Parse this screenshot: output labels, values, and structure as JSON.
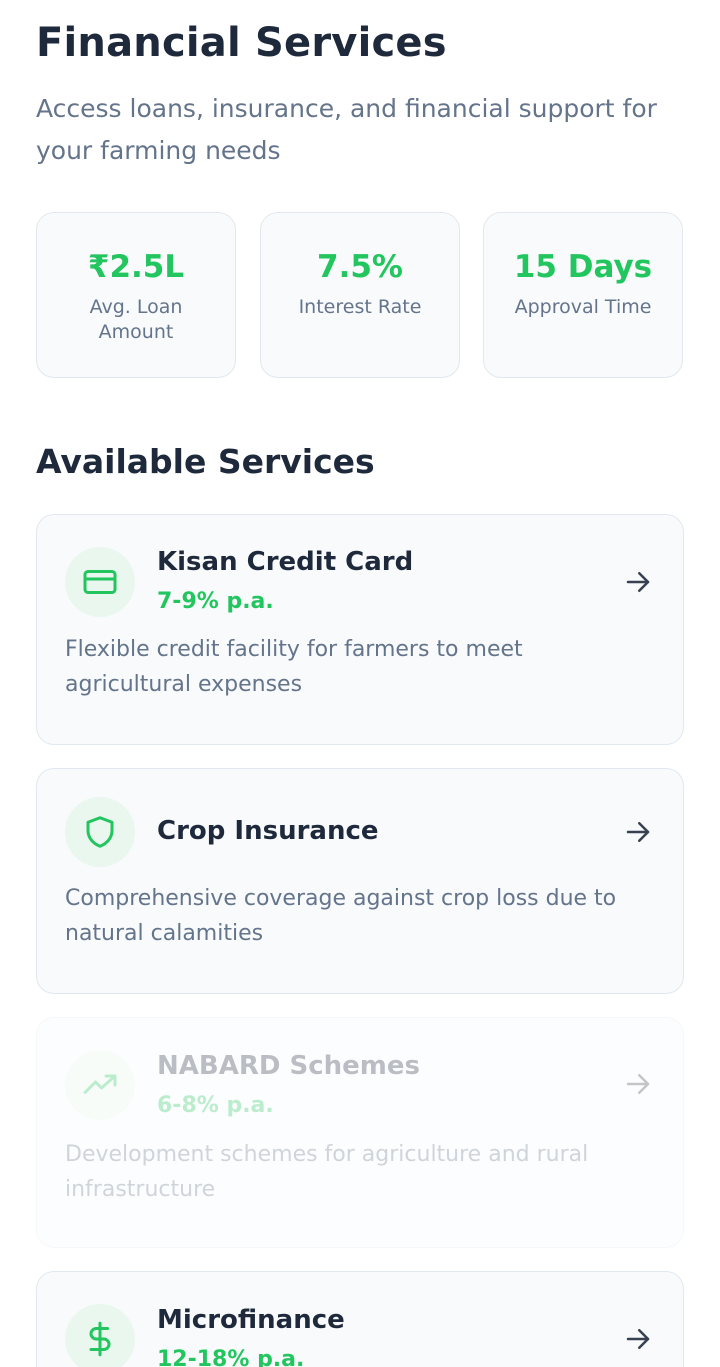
{
  "header": {
    "title": "Financial Services",
    "subtitle": "Access loans, insurance, and financial support for your farming needs"
  },
  "stats": [
    {
      "value": "₹2.5L",
      "label": "Avg. Loan Amount"
    },
    {
      "value": "7.5%",
      "label": "Interest Rate"
    },
    {
      "value": "15 Days",
      "label": "Approval Time"
    }
  ],
  "section": {
    "title": "Available Services"
  },
  "services": [
    {
      "name": "Kisan Credit Card",
      "rate": "7-9% p.a.",
      "description": "Flexible credit facility for farmers to meet agricultural expenses",
      "icon": "credit-card-icon",
      "enabled": true
    },
    {
      "name": "Crop Insurance",
      "rate": "",
      "description": "Comprehensive coverage against crop loss due to natural calamities",
      "icon": "shield-icon",
      "enabled": true
    },
    {
      "name": "NABARD Schemes",
      "rate": "6-8% p.a.",
      "description": "Development schemes for agriculture and rural infrastructure",
      "icon": "trending-up-icon",
      "enabled": false
    },
    {
      "name": "Microfinance",
      "rate": "12-18% p.a.",
      "description": "",
      "icon": "dollar-sign-icon",
      "enabled": true
    }
  ],
  "colors": {
    "accent": "#22c55e",
    "text_primary": "#1e293b",
    "text_secondary": "#64748b",
    "card_background": "#f8fafc",
    "card_border": "#e2e8f0",
    "icon_background": "#e9f7ee"
  }
}
